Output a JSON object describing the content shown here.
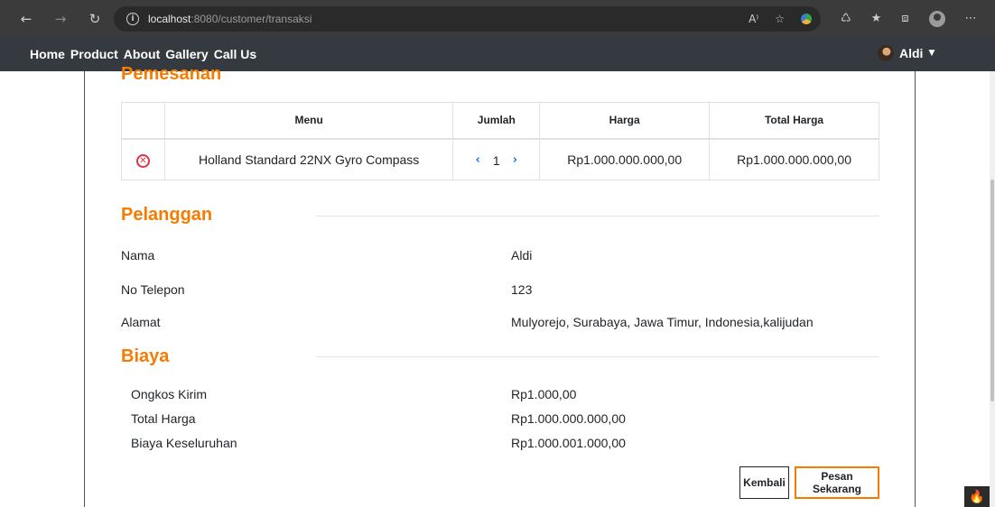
{
  "browser": {
    "url_host": "localhost",
    "url_path": ":8080/customer/transaksi",
    "icons": [
      "back-icon",
      "forward-icon",
      "reload-icon",
      "info-icon",
      "read-aloud-icon",
      "favorite-icon",
      "extension-icon",
      "puzzle-icon",
      "favorites-list-icon",
      "collections-icon",
      "profile-icon",
      "more-icon"
    ]
  },
  "navbar": {
    "links": [
      "Home",
      "Product",
      "About",
      "Gallery",
      "Call Us"
    ],
    "user": "Aldi"
  },
  "order": {
    "title": "Pemesanan",
    "headers": [
      "",
      "Menu",
      "Jumlah",
      "Harga",
      "Total Harga"
    ],
    "rows": [
      {
        "menu": "Holland Standard 22NX Gyro Compass",
        "qty": "1",
        "price": "Rp1.000.000.000,00",
        "total": "Rp1.000.000.000,00"
      }
    ]
  },
  "customer": {
    "title": "Pelanggan",
    "fields": [
      {
        "label": "Nama",
        "value": "Aldi"
      },
      {
        "label": "No Telepon",
        "value": "123"
      },
      {
        "label": "Alamat",
        "value": "Mulyorejo, Surabaya, Jawa Timur, Indonesia,kalijudan"
      }
    ]
  },
  "cost": {
    "title": "Biaya",
    "fields": [
      {
        "label": "Ongkos Kirim",
        "value": "Rp1.000,00"
      },
      {
        "label": "Total Harga",
        "value": "Rp1.000.000.000,00"
      },
      {
        "label": "Biaya Keseluruhan",
        "value": "Rp1.000.001.000,00"
      }
    ]
  },
  "actions": {
    "back": "Kembali",
    "order": "Pesan Sekarang"
  },
  "colors": {
    "accent": "#f57c00",
    "navbar": "#343a40",
    "danger": "#dc3545",
    "link": "#0d6efd"
  }
}
